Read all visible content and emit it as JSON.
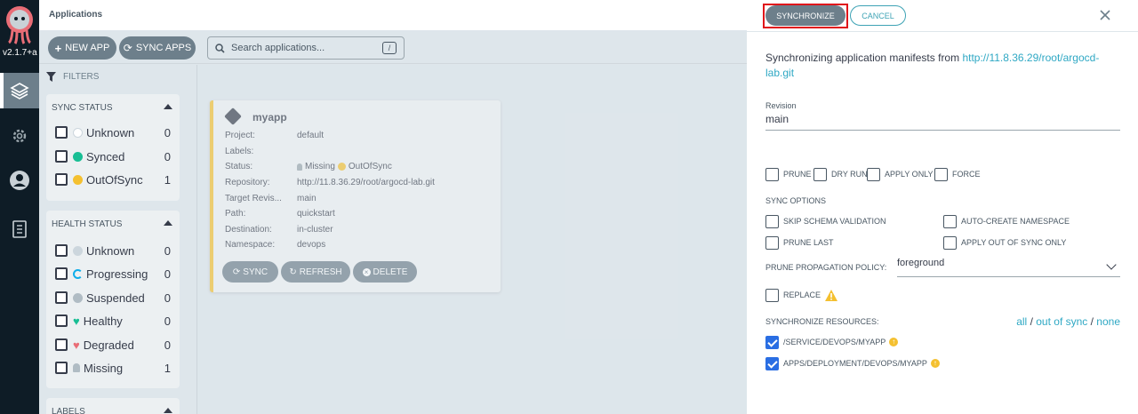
{
  "nav": {
    "version": "v2.1.7+a",
    "items": [
      "applications",
      "settings",
      "user-info",
      "documentation"
    ]
  },
  "topbar": {
    "title": "Applications"
  },
  "toolbar": {
    "new_app": "NEW APP",
    "sync_apps": "SYNC APPS",
    "search_placeholder": "Search applications...",
    "search_shortcut": "/"
  },
  "filters": {
    "heading": "FILTERS",
    "sync_status": {
      "title": "SYNC STATUS",
      "items": [
        {
          "label": "Unknown",
          "count": "0"
        },
        {
          "label": "Synced",
          "count": "0"
        },
        {
          "label": "OutOfSync",
          "count": "1"
        }
      ]
    },
    "health_status": {
      "title": "HEALTH STATUS",
      "items": [
        {
          "label": "Unknown",
          "count": "0"
        },
        {
          "label": "Progressing",
          "count": "0"
        },
        {
          "label": "Suspended",
          "count": "0"
        },
        {
          "label": "Healthy",
          "count": "0"
        },
        {
          "label": "Degraded",
          "count": "0"
        },
        {
          "label": "Missing",
          "count": "1"
        }
      ]
    },
    "labels_title": "LABELS"
  },
  "app_card": {
    "name": "myapp",
    "fields": [
      {
        "key": "Project:",
        "value": "default"
      },
      {
        "key": "Labels:",
        "value": ""
      },
      {
        "key": "Status:",
        "value": "Missing",
        "value2": "OutOfSync"
      },
      {
        "key": "Repository:",
        "value": "http://11.8.36.29/root/argocd-lab.git"
      },
      {
        "key": "Target Revis...",
        "value": "main"
      },
      {
        "key": "Path:",
        "value": "quickstart"
      },
      {
        "key": "Destination:",
        "value": "in-cluster"
      },
      {
        "key": "Namespace:",
        "value": "devops"
      }
    ],
    "buttons": {
      "sync": "SYNC",
      "refresh": "REFRESH",
      "delete": "DELETE"
    }
  },
  "sync_panel": {
    "synchronize_label": "SYNCHRONIZE",
    "cancel_label": "CANCEL",
    "intro_text": "Synchronizing application manifests from ",
    "repo_url_line1": "http://11.8.36.29/root/argocd-",
    "repo_url_line2": "lab.git",
    "revision_label": "Revision",
    "revision_value": "main",
    "options_row": [
      "PRUNE",
      "DRY RUN",
      "APPLY ONLY",
      "FORCE"
    ],
    "sync_options_title": "SYNC OPTIONS",
    "sync_options": [
      "SKIP SCHEMA VALIDATION",
      "AUTO-CREATE NAMESPACE",
      "PRUNE LAST",
      "APPLY OUT OF SYNC ONLY"
    ],
    "prune_policy_label": "PRUNE PROPAGATION POLICY:",
    "prune_policy_value": "foreground",
    "replace_label": "REPLACE",
    "resources_title": "SYNCHRONIZE RESOURCES:",
    "resources_filter": {
      "all": "all",
      "sep1": " / ",
      "out_of_sync": "out of sync",
      "sep2": " / ",
      "none": "none"
    },
    "resources": [
      {
        "name": "/SERVICE/DEVOPS/MYAPP",
        "checked": true
      },
      {
        "name": "APPS/DEPLOYMENT/DEVOPS/MYAPP",
        "checked": true
      }
    ]
  },
  "colors": {
    "nav_bg": "#0e1c26",
    "button_gray": "#6d7f8b",
    "link_teal": "#2fa8c4",
    "warning_yellow": "#f4c030",
    "synced_green": "#18be94",
    "highlight_red": "#e0131a"
  }
}
